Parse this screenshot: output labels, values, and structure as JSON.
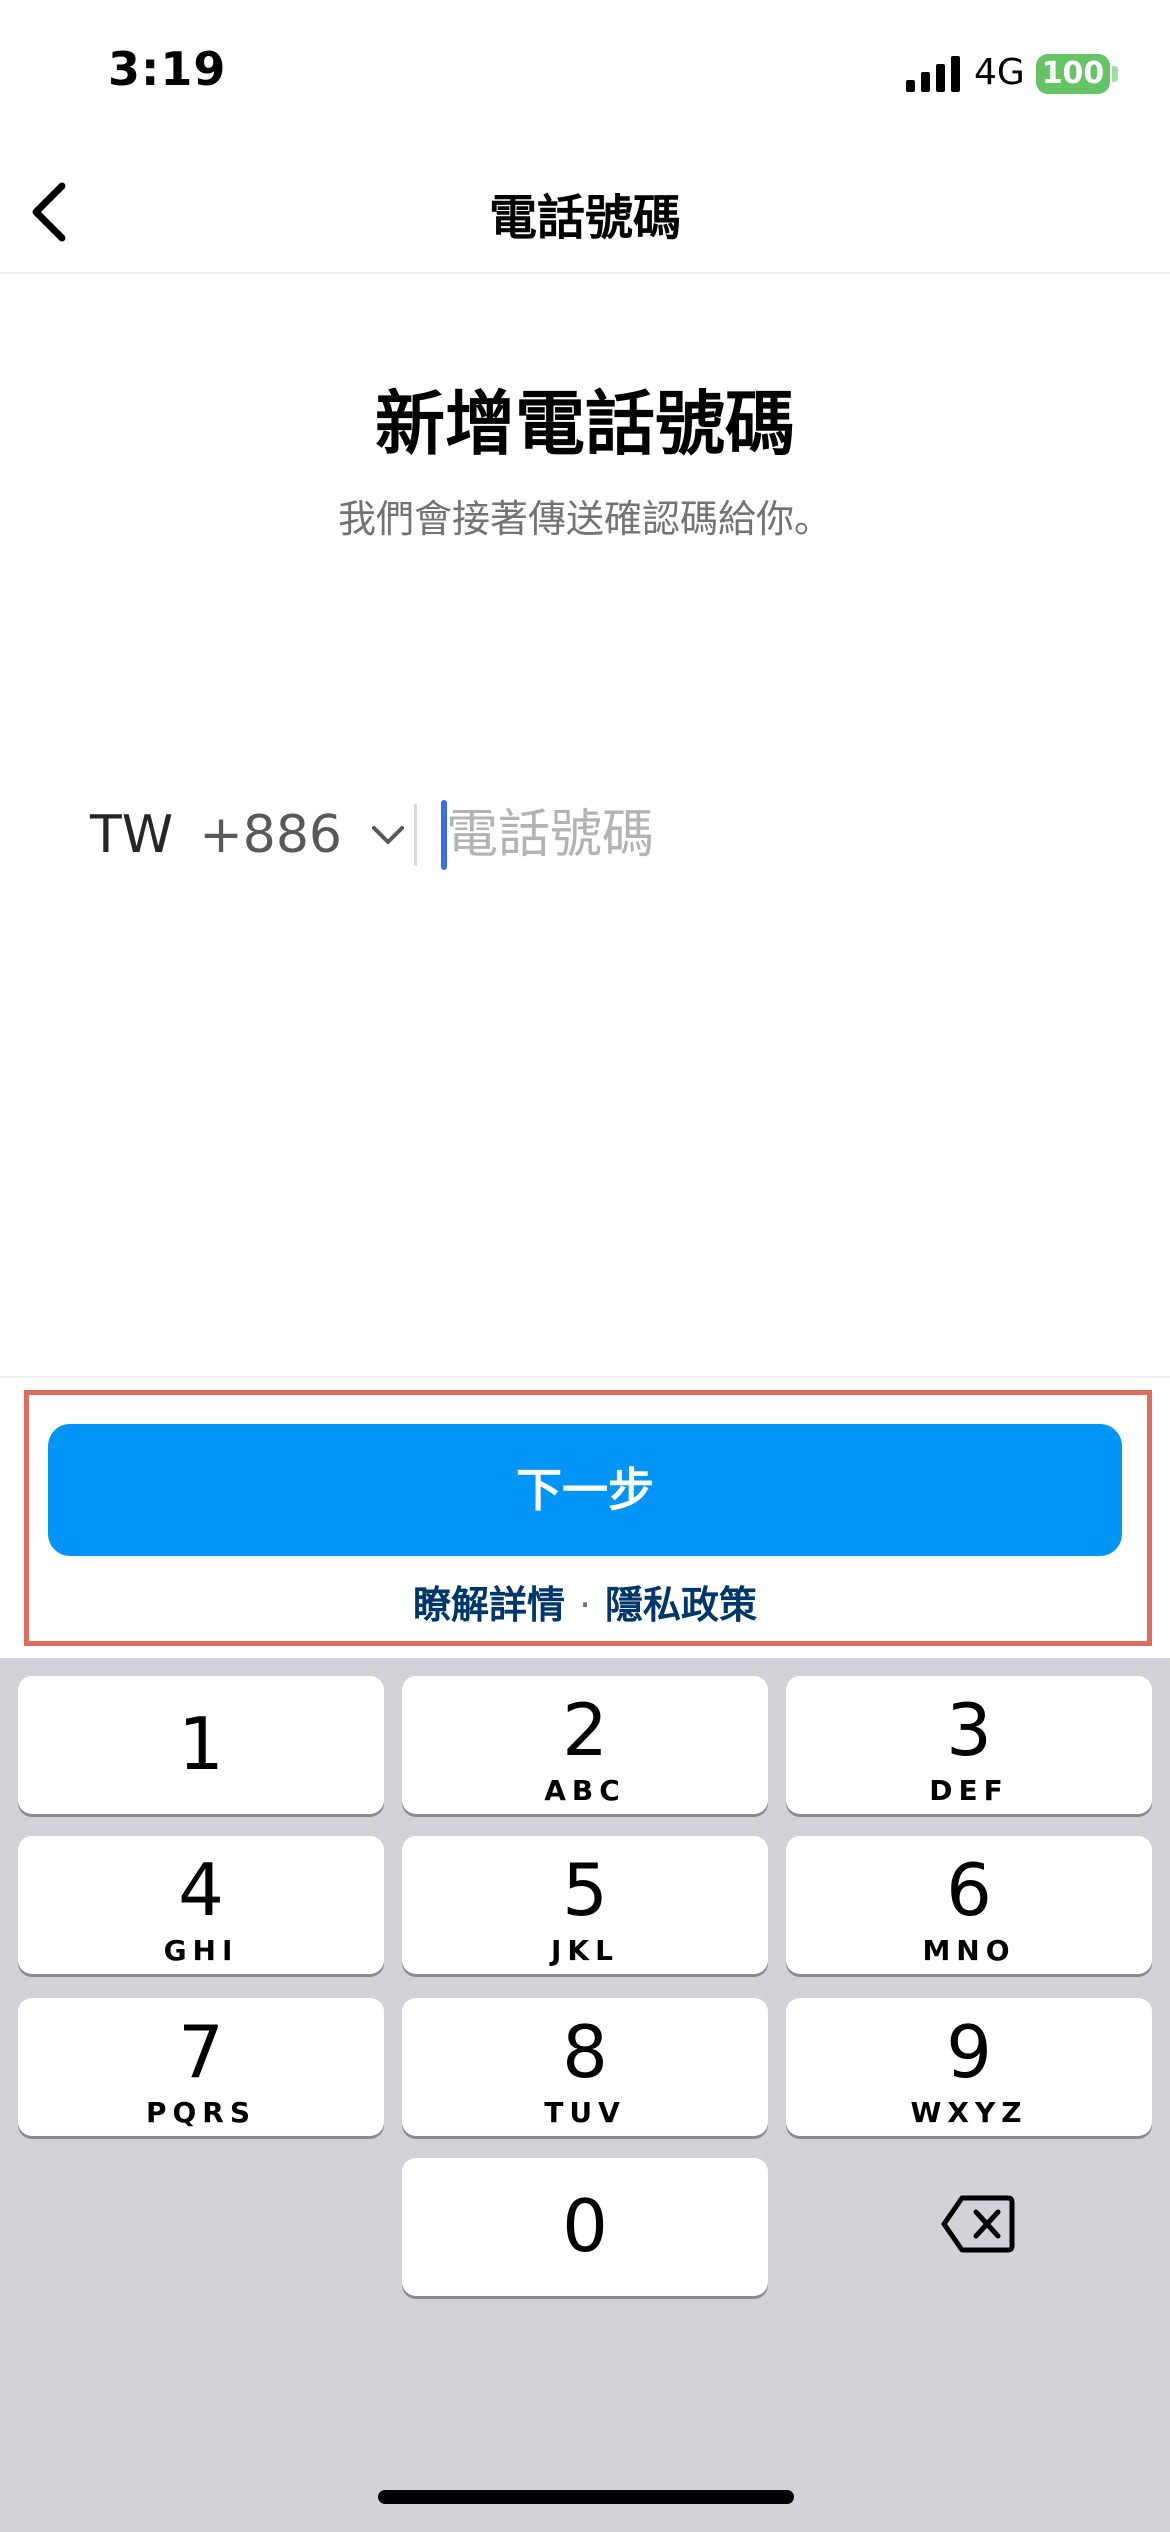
{
  "status_bar": {
    "time": "3:19",
    "network": "4G",
    "battery": "100"
  },
  "nav": {
    "title": "電話號碼",
    "back_icon": "chevron-left-icon"
  },
  "content": {
    "heading": "新增電話號碼",
    "subtitle": "我們會接著傳送確認碼給你。"
  },
  "phone_field": {
    "country": "TW",
    "country_code": "+886",
    "value": "",
    "placeholder": "電話號碼"
  },
  "actions": {
    "next_label": "下一步",
    "learn_more": "瞭解詳情",
    "separator": "·",
    "privacy_policy": "隱私政策"
  },
  "keyboard": {
    "keys": [
      {
        "digit": "1",
        "letters": ""
      },
      {
        "digit": "2",
        "letters": "ABC"
      },
      {
        "digit": "3",
        "letters": "DEF"
      },
      {
        "digit": "4",
        "letters": "GHI"
      },
      {
        "digit": "5",
        "letters": "JKL"
      },
      {
        "digit": "6",
        "letters": "MNO"
      },
      {
        "digit": "7",
        "letters": "PQRS"
      },
      {
        "digit": "8",
        "letters": "TUV"
      },
      {
        "digit": "9",
        "letters": "WXYZ"
      },
      {
        "digit": "0",
        "letters": ""
      }
    ],
    "delete_icon": "backspace-icon"
  },
  "colors": {
    "primary_button": "#0095f6",
    "link": "#00376b",
    "highlight_border": "#e06c5e",
    "battery": "#65c466",
    "keyboard_bg": "#d1d3d9"
  }
}
